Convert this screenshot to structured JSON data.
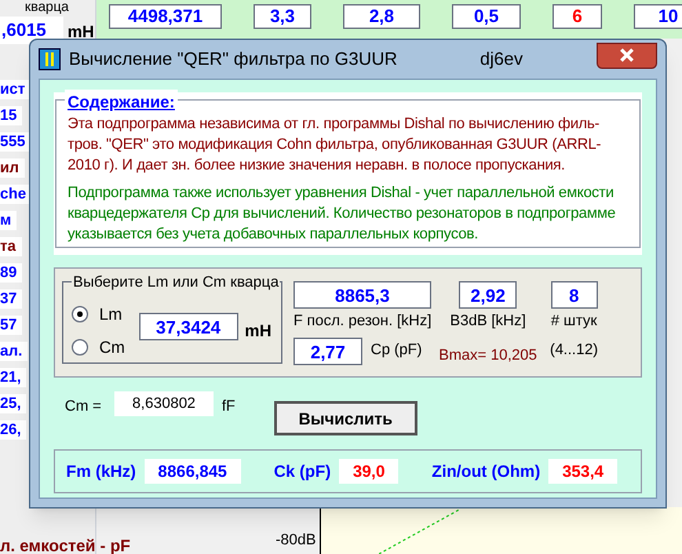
{
  "background": {
    "top_label": "кварца",
    "left_value": ",6015",
    "left_unit": "mH",
    "top_fields": [
      {
        "value": "4498,371",
        "color": "#0000ff"
      },
      {
        "value": "3,3",
        "color": "#0000ff"
      },
      {
        "value": "2,8",
        "color": "#0000ff"
      },
      {
        "value": "0,5",
        "color": "#0000ff"
      },
      {
        "value": "6",
        "color": "#ff0000"
      },
      {
        "value": "10",
        "color": "#0000ff"
      }
    ],
    "left_items": [
      {
        "text": "ист",
        "color": "#0000ff"
      },
      {
        "text": "15",
        "color": "#0000ff"
      },
      {
        "text": "555",
        "color": "#0000ff"
      },
      {
        "text": "ил",
        "color": "#800000"
      },
      {
        "text": "che",
        "color": "#0000ff"
      },
      {
        "text": "м",
        "color": "#0000ff"
      },
      {
        "text": "та",
        "color": "#800000"
      },
      {
        "text": "89",
        "color": "#0000ff"
      },
      {
        "text": "37",
        "color": "#0000ff"
      },
      {
        "text": "57",
        "color": "#0000ff"
      },
      {
        "text": "ал.",
        "color": "#0000ff"
      },
      {
        "text": "21,",
        "color": "#0000ff"
      },
      {
        "text": "25,",
        "color": "#0000ff"
      },
      {
        "text": "26,",
        "color": "#0000ff"
      }
    ],
    "bottom_label": "л. емкостей - pF",
    "chart_label": "-80dB"
  },
  "dialog": {
    "title": "Вычисление \"QER\" фильтра по G3UUR",
    "author": "dj6ev",
    "contents_heading": "Содержание:",
    "paragraph_1": "Эта подпрограмма независима от гл. программы Dishal по вычислению филь-тров. \"QER\" это модификация Cohn фильтра, опубликованная G3UUR (ARRL-2010 г). И дает зн. более низкие значения неравн. в полосе пропускания.",
    "paragraph_2": "Подпрограмма также использует уравнения Dishal  - учет параллельной емкости кварцедержателя Cp для вычислений. Количество резонаторов в подпрограмме указывается без учета добавочных параллельных корпусов.",
    "choose_label": "Выберите Lm или Cm кварца",
    "radios": [
      {
        "label": "Lm",
        "selected": true
      },
      {
        "label": "Cm",
        "selected": false
      }
    ],
    "lm_value": "37,3424",
    "lm_unit": "mH",
    "f_value": "8865,3",
    "f_label": "F посл. резон. [kHz]",
    "b3db_value": "2,92",
    "b3db_label": "B3dB [kHz]",
    "count_value": "8",
    "count_label": "# штук",
    "count_range": "(4...12)",
    "cp_value": "2,77",
    "cp_label": "Cp (pF)",
    "bmax": "Bmax= 10,205",
    "cm_label": "Cm =",
    "cm_value": "8,630802",
    "cm_unit": "fF",
    "button": "Вычислить",
    "results": [
      {
        "label": "Fm (kHz)",
        "value": "8866,845",
        "color": "#0000ff"
      },
      {
        "label": "Ck (pF)",
        "value": "39,0",
        "color": "#ff0000"
      },
      {
        "label": "Zin/out (Ohm)",
        "value": "353,4",
        "color": "#ff0000"
      }
    ]
  }
}
